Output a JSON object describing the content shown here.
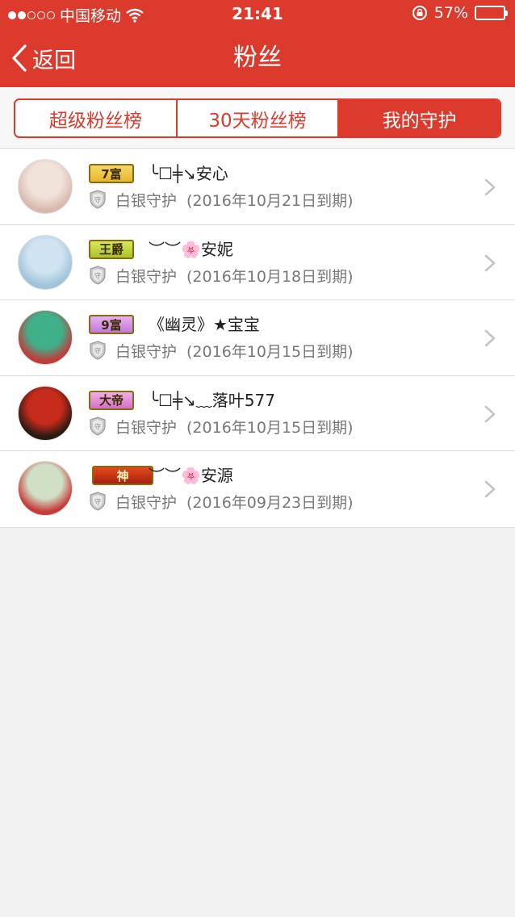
{
  "status": {
    "carrier": "中国移动",
    "time": "21:41",
    "battery": "57%",
    "battery_level": 0.57
  },
  "nav": {
    "back_label": "返回",
    "title": "粉丝"
  },
  "tabs": [
    {
      "label": "超级粉丝榜",
      "active": false
    },
    {
      "label": "30天粉丝榜",
      "active": false
    },
    {
      "label": "我的守护",
      "active": true
    }
  ],
  "list": [
    {
      "badge": "7富",
      "badge_colors": [
        "#f5d76a",
        "#e8b72a"
      ],
      "name": "╰☐╪↘安心",
      "guard_label": "白银守护",
      "expiry": "(2016年10月21日到期)",
      "avatar_colors": [
        "#f1e2da",
        "#d9b9ae"
      ]
    },
    {
      "badge": "王爵",
      "badge_colors": [
        "#d9e85a",
        "#aac32a"
      ],
      "name": "︶︶🌸安妮",
      "guard_label": "白银守护",
      "expiry": "(2016年10月18日到期)",
      "avatar_colors": [
        "#cfe3f0",
        "#9fc4db"
      ]
    },
    {
      "badge": "9富",
      "badge_colors": [
        "#e7b0f0",
        "#c27ad8"
      ],
      "name": "《幽灵》★宝宝",
      "guard_label": "白银守护",
      "expiry": "(2016年10月15日到期)",
      "avatar_colors": [
        "#3fb08a",
        "#c23a3a"
      ]
    },
    {
      "badge": "大帝",
      "badge_colors": [
        "#f0b0e6",
        "#d46fc6"
      ],
      "name": "╰☐╪↘﹏落叶577",
      "guard_label": "白银守护",
      "expiry": "(2016年10月15日到期)",
      "avatar_colors": [
        "#c52a1a",
        "#2a1a12"
      ]
    },
    {
      "badge": "神",
      "badge_colors": [
        "#e34a1a",
        "#a8200f"
      ],
      "name": "︶︶🌸安源",
      "guard_label": "白银守护",
      "expiry": "(2016年09月23日到期)",
      "avatar_colors": [
        "#cfe0c4",
        "#c73a3a"
      ]
    }
  ],
  "colors": {
    "brand_red": "#dc3a2c"
  }
}
